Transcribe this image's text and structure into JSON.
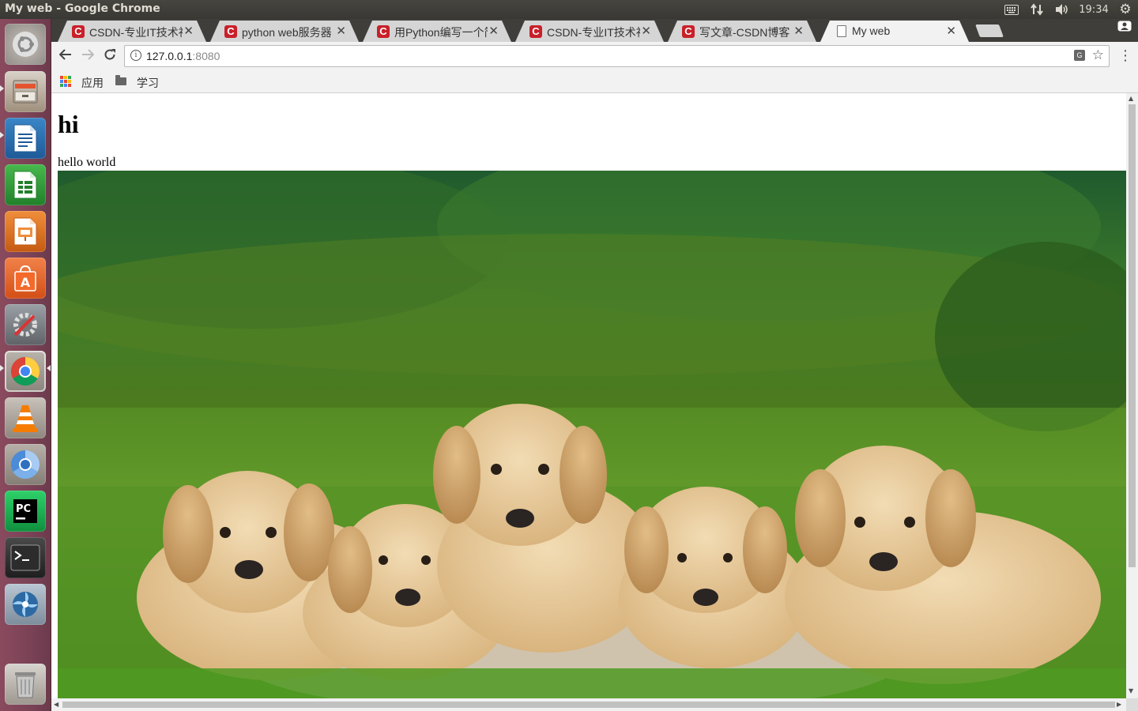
{
  "system": {
    "window_title": "My web - Google Chrome",
    "clock": "19:34"
  },
  "launcher": {
    "items": [
      {
        "name": "dash-home",
        "icon": "ubuntu-logo-icon"
      },
      {
        "name": "files",
        "icon": "file-cabinet-icon"
      },
      {
        "name": "writer",
        "icon": "libreoffice-writer-icon"
      },
      {
        "name": "calc",
        "icon": "libreoffice-calc-icon"
      },
      {
        "name": "impress",
        "icon": "libreoffice-impress-icon"
      },
      {
        "name": "software-center",
        "icon": "shopping-bag-icon"
      },
      {
        "name": "system-settings",
        "icon": "settings-wrench-icon"
      },
      {
        "name": "google-chrome",
        "icon": "chrome-icon"
      },
      {
        "name": "vlc",
        "icon": "traffic-cone-icon"
      },
      {
        "name": "chromium",
        "icon": "chromium-icon"
      },
      {
        "name": "pycharm",
        "icon": "pycharm-icon"
      },
      {
        "name": "terminal",
        "icon": "terminal-icon"
      },
      {
        "name": "shutter",
        "icon": "aperture-icon"
      },
      {
        "name": "trash",
        "icon": "trash-icon"
      }
    ]
  },
  "browser": {
    "tabs": [
      {
        "title": "CSDN-专业IT技术社",
        "favicon": "csdn-c-icon",
        "active": false
      },
      {
        "title": "python web服务器",
        "favicon": "csdn-c-icon",
        "active": false
      },
      {
        "title": "用Python编写一个简",
        "favicon": "csdn-c-icon",
        "active": false
      },
      {
        "title": "CSDN-专业IT技术社",
        "favicon": "csdn-c-icon",
        "active": false
      },
      {
        "title": "写文章-CSDN博客",
        "favicon": "csdn-c-icon",
        "active": false
      },
      {
        "title": "My web",
        "favicon": "page-icon",
        "active": true
      }
    ],
    "favicon_letter": "C",
    "url_host": "127.0.0.1",
    "url_port": ":8080",
    "bookmarks": {
      "apps_label": "应用",
      "folder_label": "学习"
    },
    "colors": {
      "csdn_red": "#c9202a",
      "apps_dots": [
        "#ea4335",
        "#fbbc05",
        "#34a853",
        "#4285f4",
        "#ea4335",
        "#fbbc05",
        "#34a853",
        "#4285f4",
        "#ea4335"
      ]
    }
  },
  "page": {
    "heading": "hi",
    "paragraph": "hello world",
    "image_description_icon": "puppies-photo"
  }
}
